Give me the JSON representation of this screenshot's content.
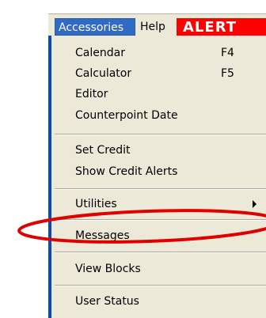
{
  "menubar": {
    "accessories": "Accessories",
    "help": "Help",
    "alert": "ALERT"
  },
  "menu": {
    "items": [
      {
        "label": "Calendar",
        "shortcut": "F4"
      },
      {
        "label": "Calculator",
        "shortcut": "F5"
      },
      {
        "label": "Editor",
        "shortcut": ""
      },
      {
        "label": "Counterpoint Date",
        "shortcut": ""
      },
      {
        "label": "Set Credit",
        "shortcut": ""
      },
      {
        "label": "Show Credit Alerts",
        "shortcut": ""
      },
      {
        "label": "Utilities",
        "shortcut": ""
      },
      {
        "label": "Messages",
        "shortcut": ""
      },
      {
        "label": "View Blocks",
        "shortcut": ""
      },
      {
        "label": "User Status",
        "shortcut": ""
      }
    ]
  },
  "colors": {
    "menu_bg": "#ece9d8",
    "selected_bg": "#316ac5",
    "alert_bg": "#ff0000",
    "highlight_ellipse": "#e00000"
  }
}
